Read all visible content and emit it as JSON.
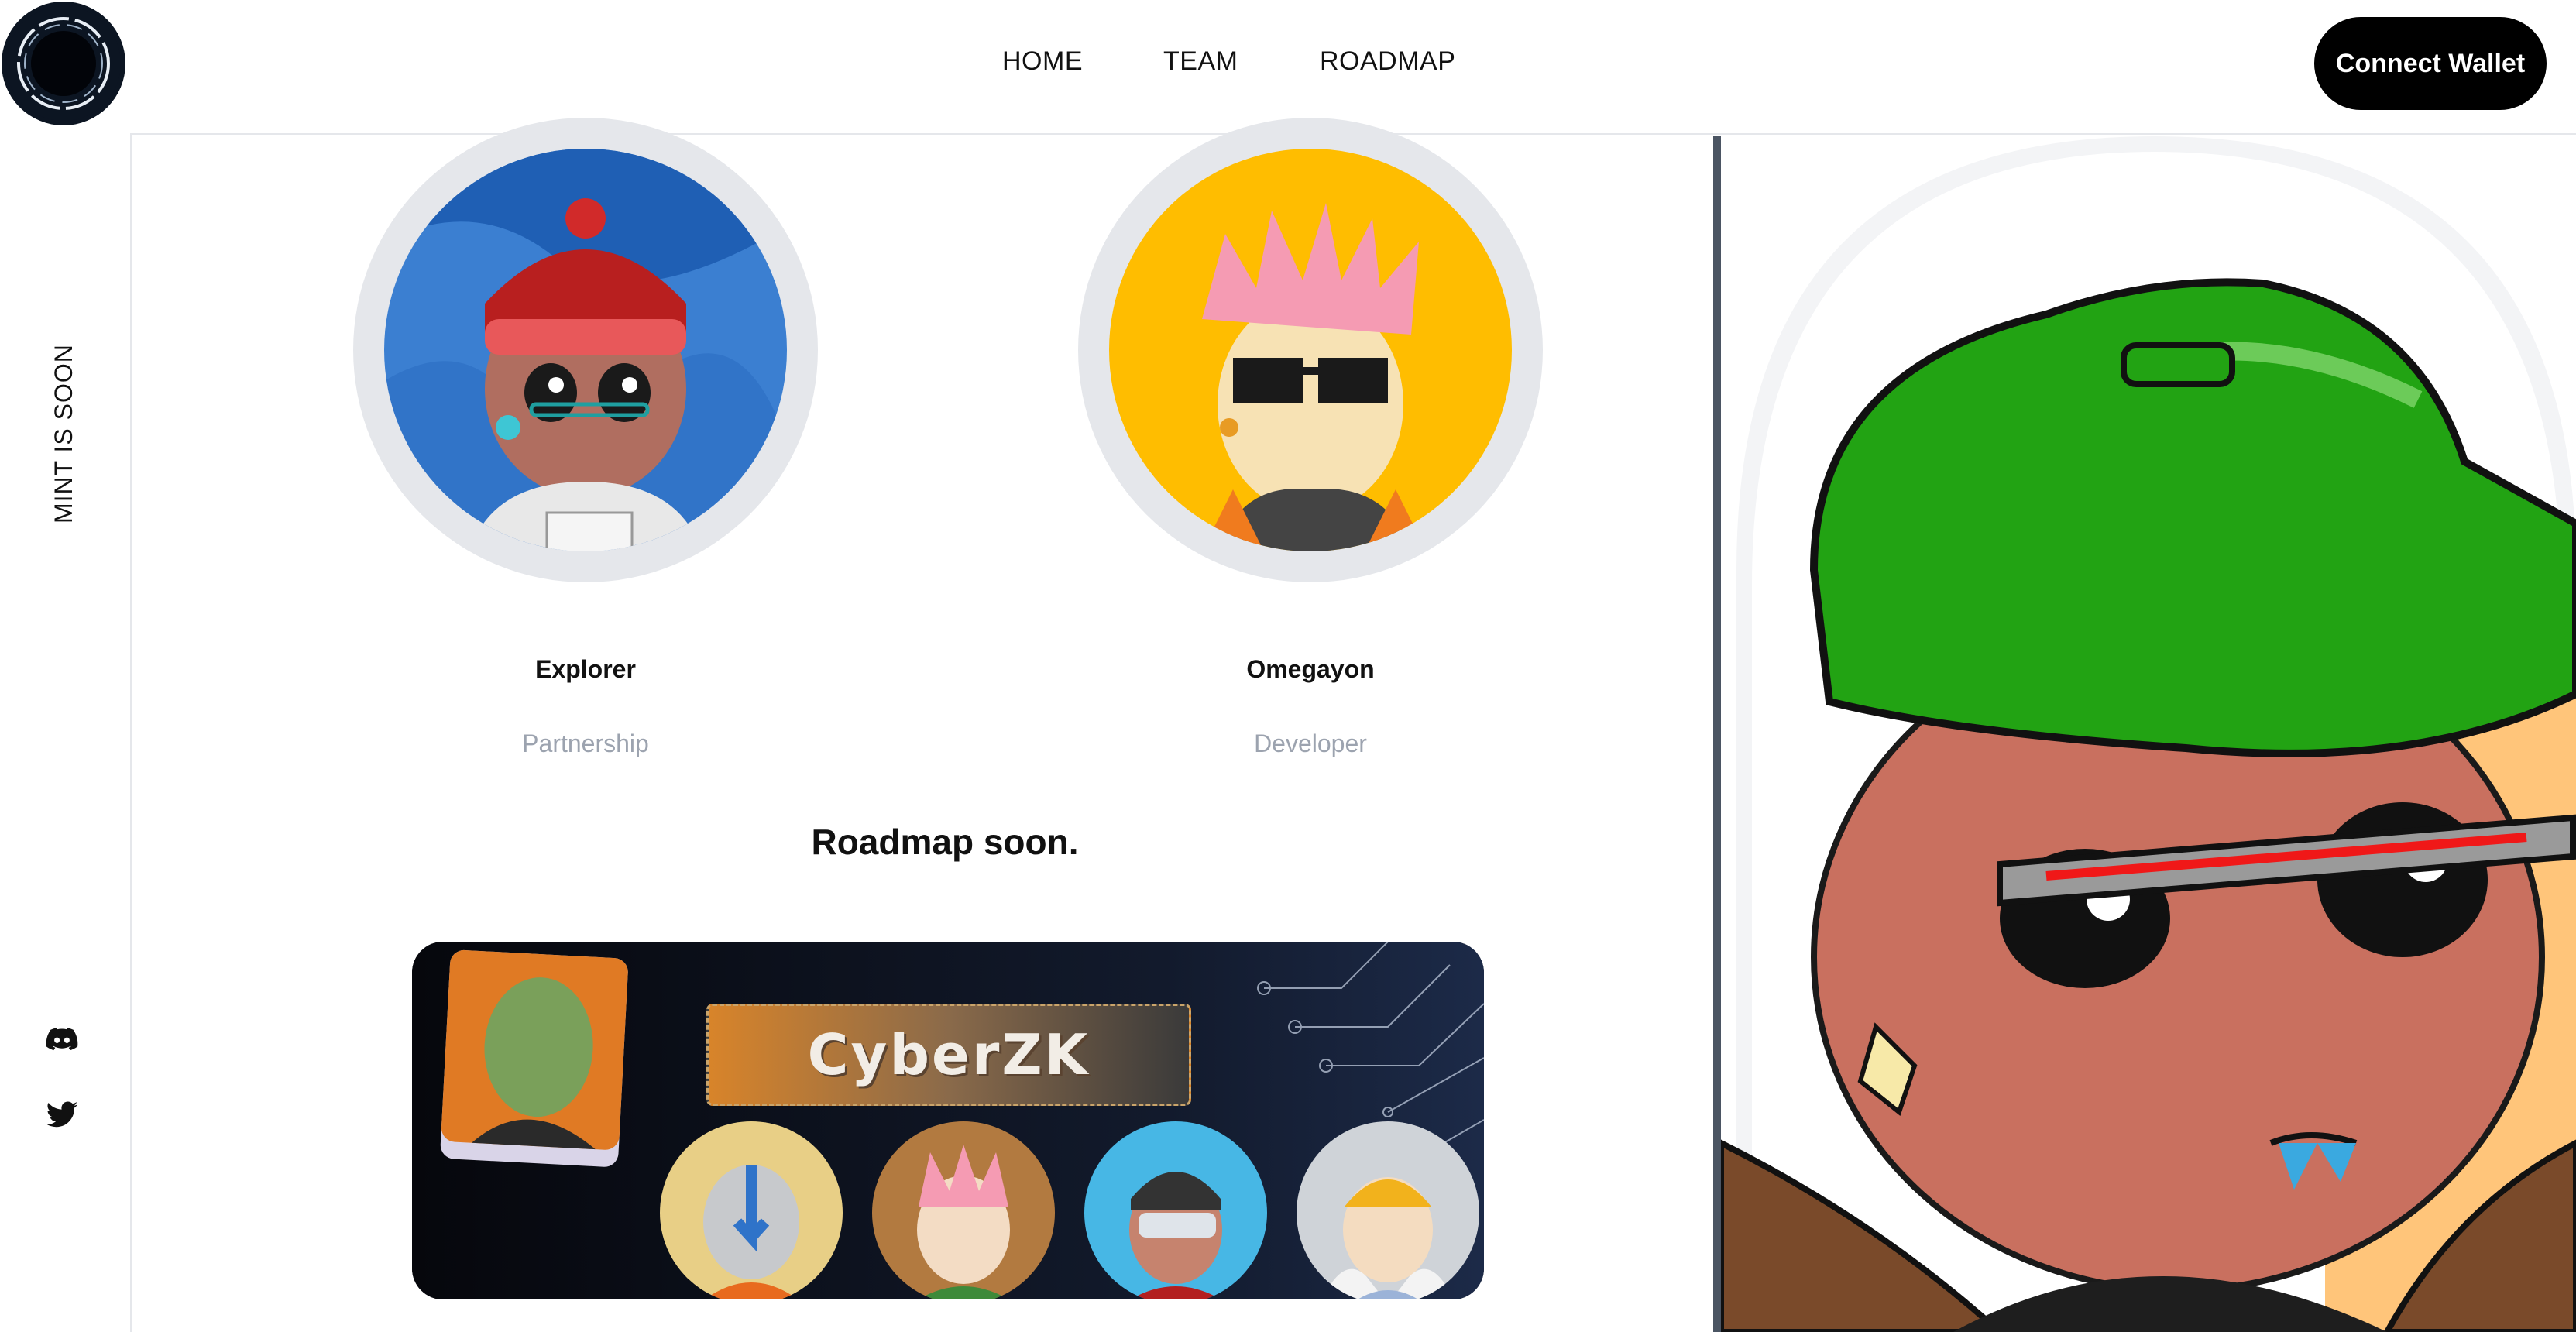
{
  "brand": {
    "logo_icon": "portal-ring-logo"
  },
  "nav": {
    "links": [
      "HOME",
      "TEAM",
      "ROADMAP"
    ],
    "connect_label": "Connect Wallet"
  },
  "sidebar": {
    "mint_text": "MINT IS SOON",
    "social": [
      {
        "icon": "discord-icon"
      },
      {
        "icon": "twitter-icon"
      }
    ]
  },
  "team": [
    {
      "name": "Explorer",
      "role": "Partnership",
      "bg": "#3b7fd1"
    },
    {
      "name": "Omegayon",
      "role": "Developer",
      "bg": "#ffbd00"
    }
  ],
  "roadmap": {
    "title": "Roadmap soon.",
    "banner_title": "CyberZK"
  },
  "colors": {
    "accent_black": "#000000",
    "divider": "#4b5563",
    "role_gray": "#9ca3af"
  }
}
